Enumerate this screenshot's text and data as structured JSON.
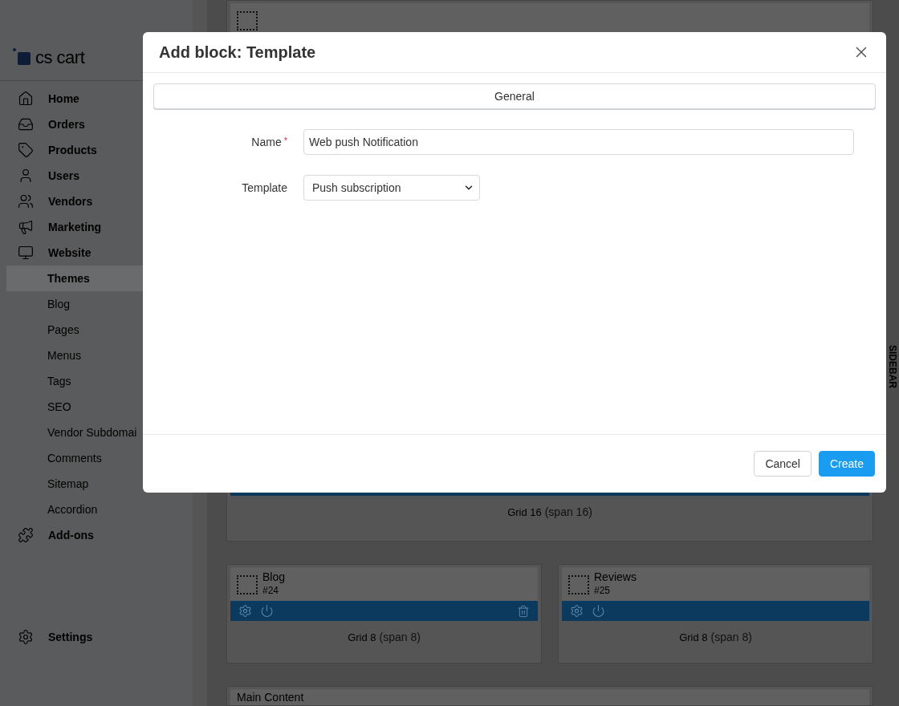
{
  "sidebar": {
    "logo": "cs cart",
    "items": [
      {
        "label": "Home"
      },
      {
        "label": "Orders"
      },
      {
        "label": "Products"
      },
      {
        "label": "Users"
      },
      {
        "label": "Vendors"
      },
      {
        "label": "Marketing"
      },
      {
        "label": "Website",
        "children": [
          {
            "label": "Themes",
            "selected": true
          },
          {
            "label": "Blog",
            "selected": false
          },
          {
            "label": "Pages",
            "selected": false
          },
          {
            "label": "Menus",
            "selected": false
          },
          {
            "label": "Tags",
            "selected": false
          },
          {
            "label": "SEO",
            "selected": false
          },
          {
            "label": "Vendor Subdomai",
            "selected": false
          },
          {
            "label": "Comments",
            "selected": false
          },
          {
            "label": "Sitemap",
            "selected": false
          },
          {
            "label": "Accordion",
            "selected": false
          }
        ]
      },
      {
        "label": "Add-ons"
      }
    ],
    "footer_item": {
      "label": "Settings"
    }
  },
  "layout": {
    "wide_grid": {
      "name": "Grid 16",
      "span": "(span 16)"
    },
    "grids": [
      {
        "name": "Grid 8",
        "span": "(span 8)",
        "block": {
          "title": "Blog",
          "id": "#24",
          "deletable": true
        }
      },
      {
        "name": "Grid 8",
        "span": "(span 8)",
        "block": {
          "title": "Reviews",
          "id": "#25",
          "deletable": false
        }
      }
    ],
    "bottom_block": {
      "title": "Main Content"
    },
    "side_tab": "SIDEBAR"
  },
  "modal": {
    "title": "Add block: Template",
    "tabs": [
      {
        "label": "General",
        "selected": true
      }
    ],
    "fields": [
      {
        "kind": "text",
        "label": "Name",
        "required_mark": "*",
        "value": "Web push Notification"
      },
      {
        "kind": "select",
        "label": "Template",
        "value": "Push subscription"
      }
    ],
    "buttons": [
      {
        "label": "Cancel",
        "kind": "secondary"
      },
      {
        "label": "Create",
        "kind": "primary"
      }
    ]
  }
}
